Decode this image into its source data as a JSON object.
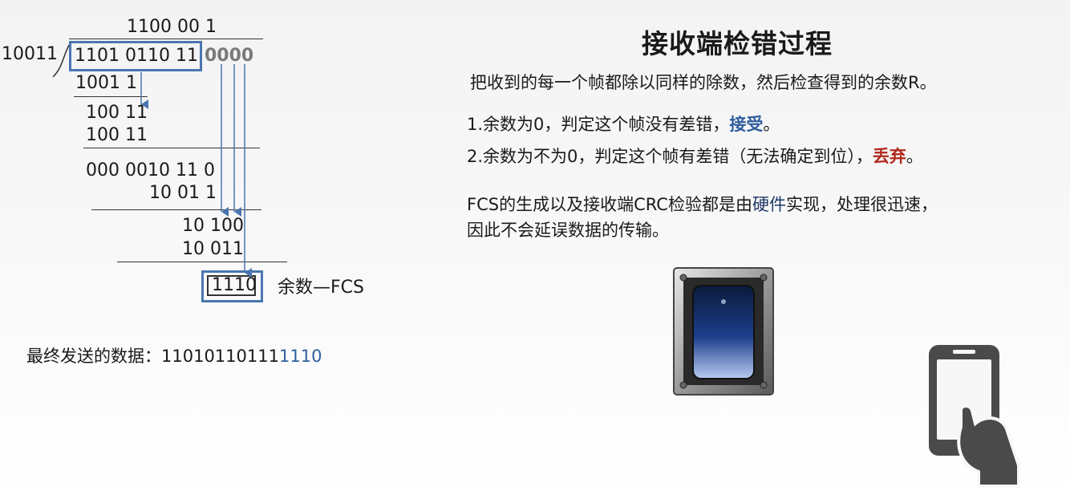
{
  "division": {
    "quotient": "1100 00 1",
    "divisor": "10011",
    "dividend_main": "1101 0110 11",
    "dividend_pad": "0000",
    "step1": "1001 1",
    "step2a": "100 11",
    "step2b": "100 11",
    "step3": "000 0010 11  0",
    "step4": "10 01 1",
    "step5a": "10 100",
    "step5b": "10 011",
    "remainder": "1110",
    "remainder_label": "余数—FCS"
  },
  "final": {
    "label": "最终发送的数据：",
    "data_main": "11010110111",
    "data_fcs": "1110"
  },
  "right": {
    "title": "接收端检错过程",
    "intro": "把收到的每一个帧都除以同样的除数，然后检查得到的余数R。",
    "item1_text": "1.余数为0，判定这个帧没有差错，",
    "item1_accent": "接受",
    "item1_end": "。",
    "item2_text": "2.余数为不为0，判定这个帧有差错（无法确定到位），",
    "item2_accent": "丢弃",
    "item2_end": "。",
    "note_line1_a": "FCS的生成以及接收端CRC检验都是由",
    "note_line1_b": "硬件",
    "note_line1_c": "实现，处理很迅速，",
    "note_line2": "因此不会延误数据的传输。"
  },
  "colors": {
    "accent_blue": "#2f5f9e",
    "accent_red": "#b0281e",
    "box_blue": "#4a76b0"
  },
  "icons": [
    "rocker-switch-icon",
    "hand-holding-phone-icon"
  ]
}
